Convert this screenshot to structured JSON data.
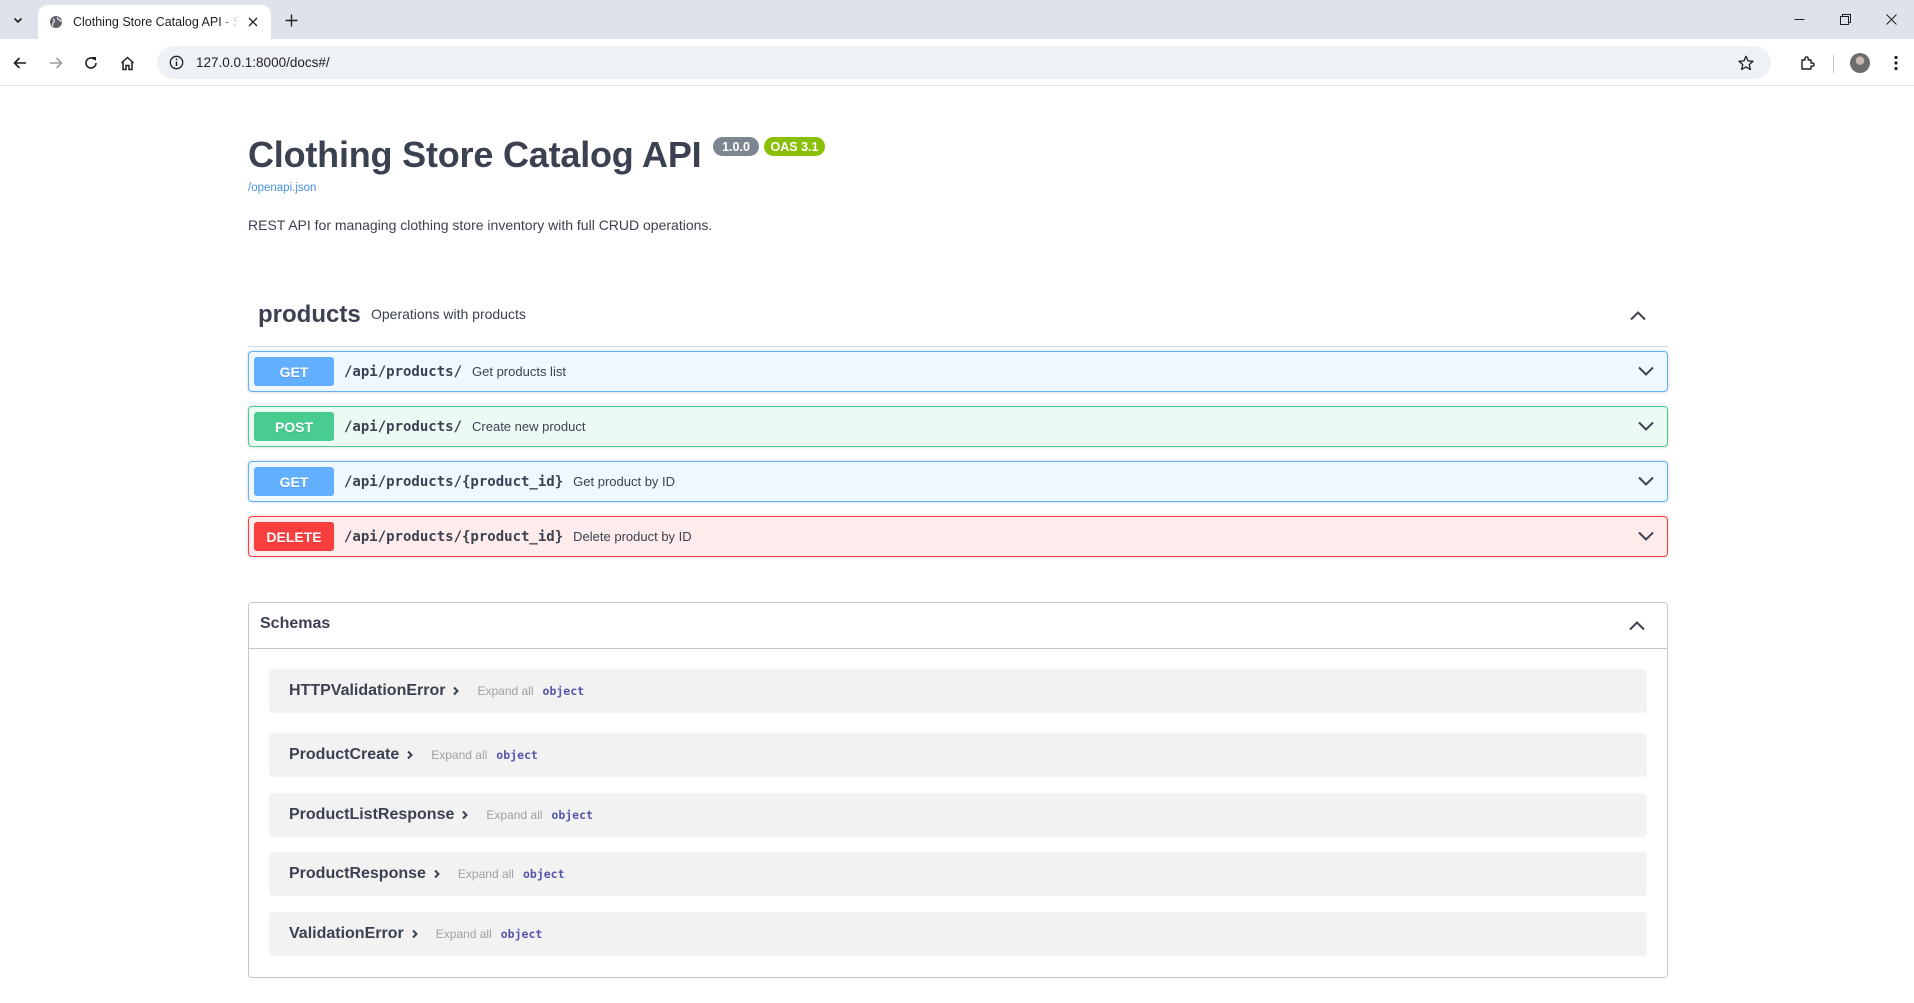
{
  "browser": {
    "tab_title": "Clothing Store Catalog API - Swagger UI",
    "url": "127.0.0.1:8000/docs#/"
  },
  "info": {
    "title": "Clothing Store Catalog API",
    "version": "1.0.0",
    "oas": "OAS 3.1",
    "spec_link": "/openapi.json",
    "description": "REST API for managing clothing store inventory with full CRUD operations."
  },
  "tag": {
    "name": "products",
    "description": "Operations with products"
  },
  "operations": [
    {
      "method": "GET",
      "path": "/api/products/",
      "summary": "Get products list"
    },
    {
      "method": "POST",
      "path": "/api/products/",
      "summary": "Create new product"
    },
    {
      "method": "GET",
      "path": "/api/products/{product_id}",
      "summary": "Get product by ID"
    },
    {
      "method": "DELETE",
      "path": "/api/products/{product_id}",
      "summary": "Delete product by ID"
    }
  ],
  "schemas": {
    "title": "Schemas",
    "items": [
      {
        "name": "HTTPValidationError",
        "expand": "Expand all",
        "type": "object"
      },
      {
        "name": "ProductCreate",
        "expand": "Expand all",
        "type": "object"
      },
      {
        "name": "ProductListResponse",
        "expand": "Expand all",
        "type": "object"
      },
      {
        "name": "ProductResponse",
        "expand": "Expand all",
        "type": "object"
      },
      {
        "name": "ValidationError",
        "expand": "Expand all",
        "type": "object"
      }
    ]
  },
  "colors": {
    "get": "#61affe",
    "post": "#49cc90",
    "delete": "#f93e3e",
    "version_badge": "#7d8492",
    "oas_badge": "#89bf04",
    "link": "#4990e2"
  }
}
